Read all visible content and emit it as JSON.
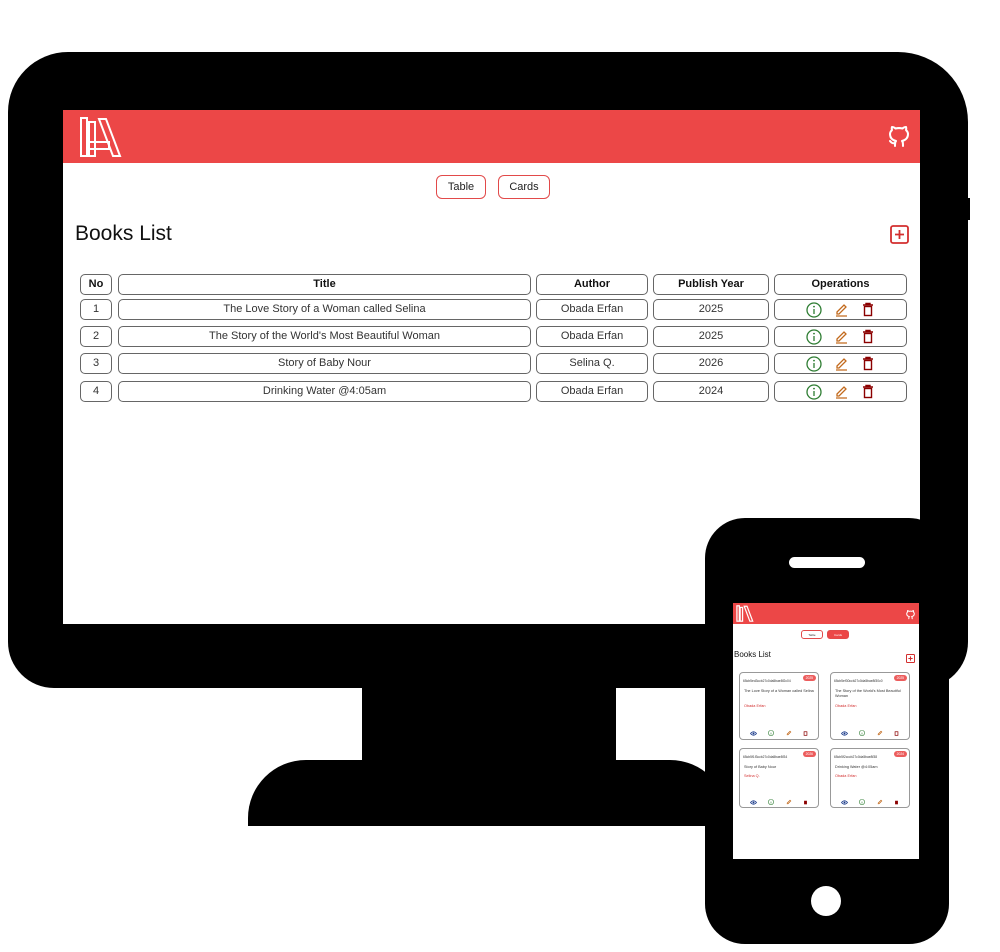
{
  "desktop": {
    "toggle": {
      "table_label": "Table",
      "cards_label": "Cards"
    },
    "page_title": "Books List",
    "table": {
      "headers": [
        "No",
        "Title",
        "Author",
        "Publish Year",
        "Operations"
      ],
      "rows": [
        {
          "no": "1",
          "title": "The Love Story of a Woman called Selina",
          "author": "Obada Erfan",
          "year": "2025"
        },
        {
          "no": "2",
          "title": "The Story of the World's Most Beautiful Woman",
          "author": "Obada Erfan",
          "year": "2025"
        },
        {
          "no": "3",
          "title": "Story of Baby Nour",
          "author": "Selina Q.",
          "year": "2026"
        },
        {
          "no": "4",
          "title": "Drinking Water @4:05am",
          "author": "Obada Erfan",
          "year": "2024"
        }
      ]
    }
  },
  "mobile": {
    "toggle": {
      "table_label": "Table",
      "cards_label": "Cards"
    },
    "page_title": "Books List",
    "cards": [
      {
        "id": "65cb5ed3ccb27c0da5bae8f2c04",
        "year": "2025",
        "title": "The Love Story of a Woman called Selina",
        "author": "Obada Erfan"
      },
      {
        "id": "65cb5ef30ccb27c0da5bae8f30c0",
        "year": "2025",
        "title": "The Story of the World's Most Beautiful Woman",
        "author": "Obada Erfan"
      },
      {
        "id": "65cb5f1f3ccb27c0da5bae8f34",
        "year": "2026",
        "title": "Story of Baby Nour",
        "author": "Selina Q."
      },
      {
        "id": "65cb5f2cccb27c0da5bae8f38",
        "year": "2024",
        "title": "Drinking Water @4:05am",
        "author": "Obada Erfan"
      }
    ]
  },
  "colors": {
    "brand_red": "#ec4747",
    "info_green": "#2e7d32",
    "edit_orange": "#c26a1d",
    "delete_red": "#8b0000",
    "view_blue": "#1a3a8a"
  },
  "icons": [
    "books-logo-icon",
    "github-icon",
    "plus-square-icon",
    "info-circle-icon",
    "pencil-icon",
    "trash-icon",
    "eye-icon"
  ]
}
